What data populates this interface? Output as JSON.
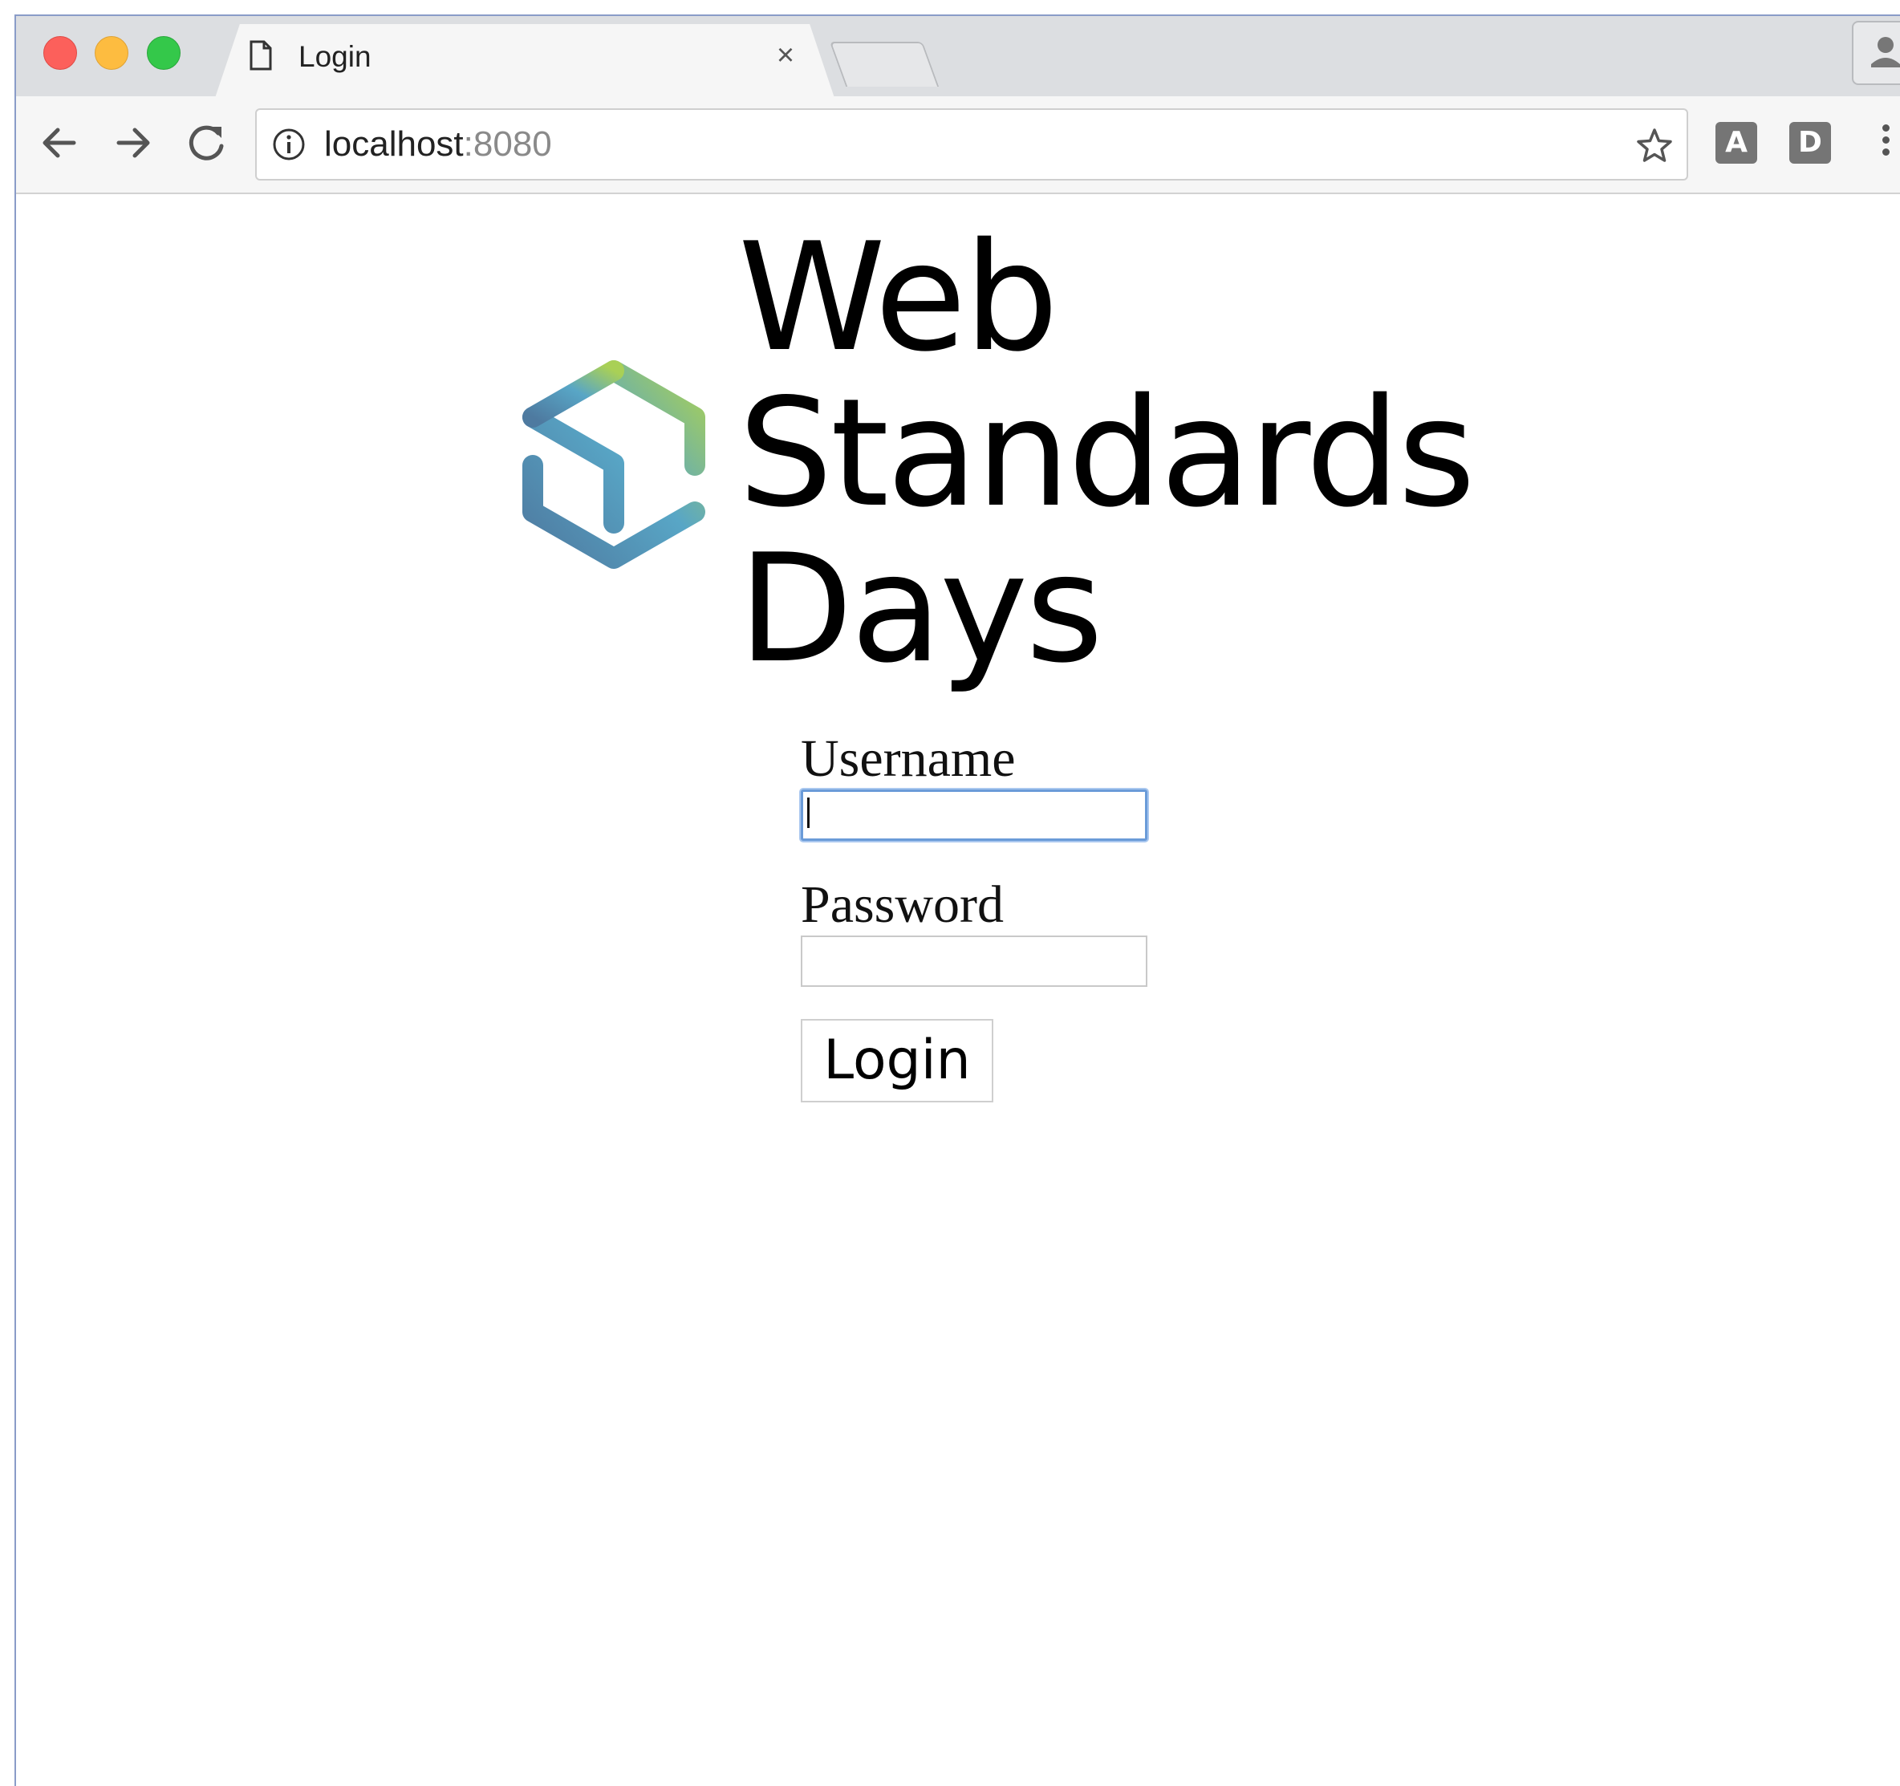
{
  "browser": {
    "tab": {
      "title": "Login",
      "close_symbol": "×",
      "icon": "page-icon"
    },
    "address_bar": {
      "host": "localhost",
      "port": ":8080"
    },
    "extensions": [
      {
        "label": "A",
        "icon": "extension-a-icon"
      },
      {
        "label": "D",
        "icon": "extension-d-icon"
      }
    ],
    "controls": {
      "back_icon": "arrow-left-icon",
      "forward_icon": "arrow-right-icon",
      "reload_icon": "reload-icon",
      "bookmark_icon": "star-icon",
      "menu_icon": "kebab-menu-icon",
      "profile_icon": "profile-icon"
    },
    "colors": {
      "close": "#fc605b",
      "minimize": "#fdbc40",
      "maximize": "#34c84a"
    }
  },
  "page": {
    "logo": {
      "line1": "Web",
      "line2": "Standards",
      "line3": "Days",
      "mark_colors": [
        "#4e7aa0",
        "#58a6c6",
        "#a9d056"
      ]
    },
    "form": {
      "username_label": "Username",
      "username_value": "",
      "password_label": "Password",
      "password_value": "",
      "submit_label": "Login"
    }
  }
}
